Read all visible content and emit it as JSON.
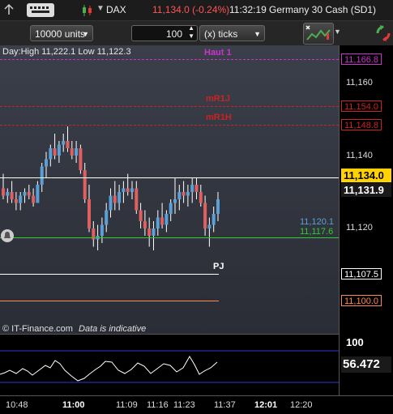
{
  "header": {
    "instrument_label": "DAX",
    "price": "11,134.0 (-0.24%)",
    "time": "11:32:19",
    "market_name": "Germany 30 Cash (SD1)"
  },
  "toolbar": {
    "units_value": "10000 units",
    "quantity_value": "100",
    "ticks_value": "(x) ticks"
  },
  "chart": {
    "day_info": "Day:High 11,222.1 Low 11,122.3",
    "levels": [
      {
        "name": "Haut 1",
        "price": "11,166.8",
        "color": "#cc33cc"
      },
      {
        "name": "mR1J",
        "price": "11,154.0",
        "color": "#cc2222"
      },
      {
        "name": "mR1H",
        "price": "11,148.8",
        "color": "#cc2222"
      },
      {
        "name": "PJ",
        "price": "11,107.5",
        "color": "#ffffff"
      },
      {
        "name": "",
        "price": "11,100.0",
        "color": "#ff8a50"
      },
      {
        "name": "",
        "price": "11,117.6",
        "color": "#33cc33"
      }
    ],
    "axis_ticks": [
      "11,160",
      "11,140",
      "11,120"
    ],
    "current_price": "11,134.0",
    "last_close": "11,131.9",
    "blue_level": "11,120.1",
    "watermark": "© IT-Finance.com",
    "watermark_note": "Data is indicative",
    "colors": {
      "bull": "#5aa0d8",
      "bear": "#e06060"
    }
  },
  "oscillator": {
    "max_label": "100",
    "value": "56.472"
  },
  "xaxis": {
    "labels": [
      {
        "t": "10:48",
        "bold": false
      },
      {
        "t": "11:00",
        "bold": true
      },
      {
        "t": "11:09",
        "bold": false
      },
      {
        "t": "11:16",
        "bold": false
      },
      {
        "t": "11:23",
        "bold": false
      },
      {
        "t": "11:37",
        "bold": false
      },
      {
        "t": "12:01",
        "bold": true
      },
      {
        "t": "12:20",
        "bold": false
      }
    ]
  },
  "chart_data": {
    "type": "candlestick",
    "ohlc": [
      [
        11137,
        11141,
        11134,
        11135
      ],
      [
        11135,
        11137,
        11133,
        11136
      ],
      [
        11136,
        11139,
        11133,
        11134
      ],
      [
        11134,
        11136,
        11131,
        11133
      ],
      [
        11133,
        11136,
        11131,
        11135
      ],
      [
        11135,
        11137,
        11133,
        11136
      ],
      [
        11136,
        11138,
        11134,
        11135
      ],
      [
        11135,
        11137,
        11132,
        11133
      ],
      [
        11133,
        11139,
        11133,
        11138
      ],
      [
        11138,
        11144,
        11136,
        11143
      ],
      [
        11143,
        11147,
        11140,
        11145
      ],
      [
        11145,
        11149,
        11143,
        11148
      ],
      [
        11148,
        11152,
        11145,
        11146
      ],
      [
        11146,
        11150,
        11144,
        11149
      ],
      [
        11149,
        11152,
        11147,
        11150
      ],
      [
        11150,
        11154,
        11147,
        11148
      ],
      [
        11148,
        11150,
        11145,
        11146
      ],
      [
        11146,
        11150,
        11144,
        11148
      ],
      [
        11148,
        11149,
        11141,
        11142
      ],
      [
        11142,
        11144,
        11133,
        11134
      ],
      [
        11134,
        11138,
        11125,
        11126
      ],
      [
        11126,
        11128,
        11121,
        11123
      ],
      [
        11123,
        11127,
        11120,
        11124
      ],
      [
        11124,
        11129,
        11122,
        11127
      ],
      [
        11127,
        11133,
        11125,
        11131
      ],
      [
        11131,
        11137,
        11129,
        11135
      ],
      [
        11135,
        11139,
        11131,
        11133
      ],
      [
        11133,
        11138,
        11131,
        11136
      ],
      [
        11136,
        11139,
        11133,
        11137
      ],
      [
        11137,
        11141,
        11135,
        11136
      ],
      [
        11136,
        11139,
        11134,
        11137
      ],
      [
        11137,
        11139,
        11130,
        11131
      ],
      [
        11131,
        11133,
        11126,
        11128
      ],
      [
        11128,
        11131,
        11124,
        11126
      ],
      [
        11126,
        11129,
        11121,
        11124
      ],
      [
        11124,
        11128,
        11120,
        11126
      ],
      [
        11126,
        11131,
        11124,
        11129
      ],
      [
        11129,
        11133,
        11126,
        11127
      ],
      [
        11127,
        11131,
        11125,
        11130
      ],
      [
        11130,
        11134,
        11128,
        11133
      ],
      [
        11133,
        11140,
        11130,
        11134
      ],
      [
        11134,
        11138,
        11131,
        11136
      ],
      [
        11136,
        11139,
        11133,
        11135
      ],
      [
        11135,
        11138,
        11132,
        11136
      ],
      [
        11136,
        11140,
        11133,
        11138
      ],
      [
        11138,
        11140,
        11134,
        11136
      ],
      [
        11136,
        11138,
        11132,
        11133
      ],
      [
        11133,
        11135,
        11124,
        11126
      ],
      [
        11126,
        11129,
        11121,
        11127
      ],
      [
        11127,
        11132,
        11125,
        11130
      ],
      [
        11130,
        11136,
        11128,
        11134
      ]
    ]
  }
}
